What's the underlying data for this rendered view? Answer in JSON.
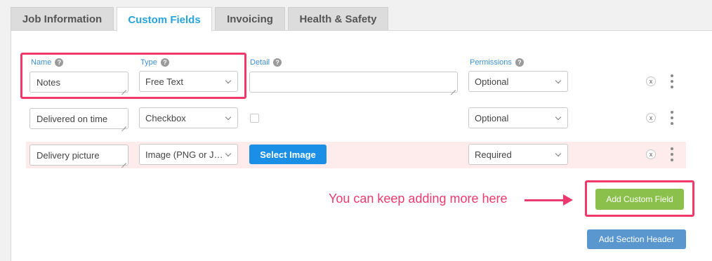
{
  "tabs": [
    {
      "label": "Job Information",
      "active": false
    },
    {
      "label": "Custom Fields",
      "active": true
    },
    {
      "label": "Invoicing",
      "active": false
    },
    {
      "label": "Health & Safety",
      "active": false
    }
  ],
  "columns": {
    "name": "Name",
    "type": "Type",
    "detail": "Detail",
    "permissions": "Permissions",
    "help_glyph": "?"
  },
  "rows": [
    {
      "name": "Notes",
      "type": "Free Text",
      "detail": "",
      "permission": "Optional"
    },
    {
      "name": "Delivered on time",
      "type": "Checkbox",
      "detail_checked": false,
      "permission": "Optional"
    },
    {
      "name": "Delivery picture",
      "type": "Image (PNG or J…",
      "detail_button": "Select Image",
      "permission": "Required"
    }
  ],
  "row_remove_glyph": "x",
  "annotation": "You can keep adding more here",
  "buttons": {
    "add_custom_field": "Add Custom Field",
    "add_section_header": "Add Section Header"
  },
  "colors": {
    "accent_tab": "#29a3db",
    "highlight": "#f0386b",
    "add_field": "#8ac04b",
    "section_header": "#5b97cf",
    "select_image": "#1b8ee6",
    "error_row": "#fdeceb"
  }
}
